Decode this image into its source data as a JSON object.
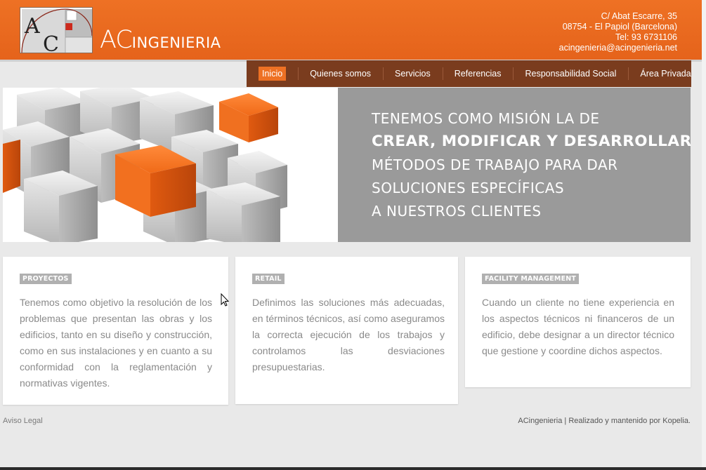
{
  "brand": {
    "logo_mark": "AC",
    "name_prefix": "AC",
    "name_suffix": "INGENIERIA"
  },
  "contact": {
    "address": "C/ Abat Escarre, 35",
    "city": "08754 - El Papiol (Barcelona)",
    "phone": "Tel: 93 6731106",
    "email": "acingenieria@acingenieria.net"
  },
  "nav": {
    "items": [
      {
        "label": "Inicio",
        "active": true
      },
      {
        "label": "Quienes somos"
      },
      {
        "label": "Servicios"
      },
      {
        "label": "Referencias"
      },
      {
        "label": "Responsabilidad Social"
      },
      {
        "label": "Área Privada"
      }
    ]
  },
  "hero": {
    "lines": [
      "TENEMOS COMO MISIÓN LA DE",
      "CREAR, MODIFICAR Y DESARROLLAR",
      "MÉTODOS DE TRABAJO PARA DAR",
      "SOLUCIONES ESPECÍFICAS",
      "A NUESTROS CLIENTES"
    ]
  },
  "cards": [
    {
      "title": "PROYECTOS",
      "text": "Tenemos como objetivo la resolución de los problemas que presentan las obras y los edificios, tanto en su diseño y construcción, como en sus instalaciones y en cuanto a su conformidad con la reglamentación y normativas vigentes."
    },
    {
      "title": "RETAIL",
      "text": "Definimos las soluciones más adecuadas, en términos técnicos, así como aseguramos la correcta ejecución de los trabajos y controlamos las desviaciones presupuestarias."
    },
    {
      "title": "FACILITY MANAGEMENT",
      "text": "Cuando un cliente no tiene experiencia en los aspectos técnicos ni financeros de un edificio, debe designar a un director técnico que gestione y coordine dichos aspectos."
    }
  ],
  "footer": {
    "legal": "Aviso Legal",
    "credits": "ACingenieria | Realizado y mantenido por Kopelia."
  },
  "colors": {
    "orange": "#ee7124",
    "nav_brown": "#7a3c1e",
    "hero_gray": "#9a9a9a"
  }
}
